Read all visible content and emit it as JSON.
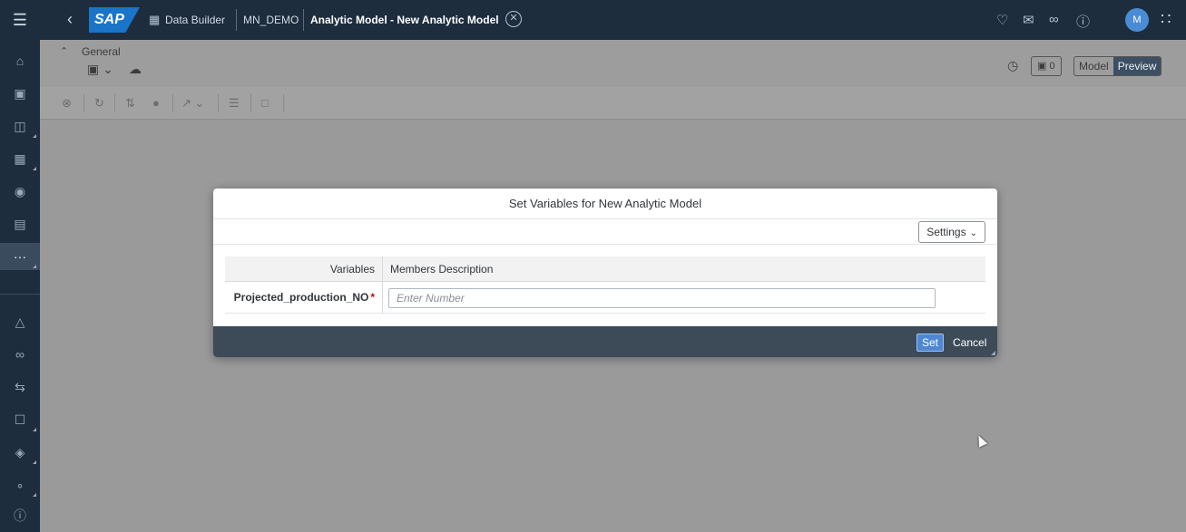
{
  "shell": {
    "logo": "SAP",
    "breadcrumbs": [
      "Data Builder",
      "MN_DEMO",
      "Analytic Model - New Analytic Model"
    ],
    "avatar_initial": "M",
    "icons": [
      "menu-icon",
      "back-icon",
      "data-builder-icon",
      "close-tab-icon",
      "bell-icon",
      "feedback-icon",
      "link-icon",
      "help-icon",
      "apps-grid-icon"
    ]
  },
  "sidenav": {
    "items": [
      "home-icon",
      "repository-icon",
      "catalog-icon",
      "data-marketplace-icon",
      "business-builder-icon",
      "data-builder-icon",
      "more-icon",
      "data-access-icon",
      "data-integration-icon",
      "transformation-icon",
      "security-icon",
      "packages-icon",
      "connections-icon",
      "info-icon"
    ]
  },
  "header": {
    "section_title": "General",
    "badge_count": "0",
    "mode_tabs": [
      "Model",
      "Preview"
    ],
    "selected_mode": "Preview"
  },
  "dialog": {
    "title": "Set Variables for New Analytic Model",
    "settings_label": "Settings",
    "columns": [
      "Variables",
      "Members Description"
    ],
    "rows": [
      {
        "variable": "Projected_production_NO",
        "required_marker": "*",
        "placeholder": "Enter Number",
        "value": ""
      }
    ],
    "set_label": "Set",
    "cancel_label": "Cancel"
  },
  "colors": {
    "shell": "#1d2d3e",
    "footer": "#3d4a58",
    "accent": "#4e88d4",
    "required": "#d10000"
  }
}
